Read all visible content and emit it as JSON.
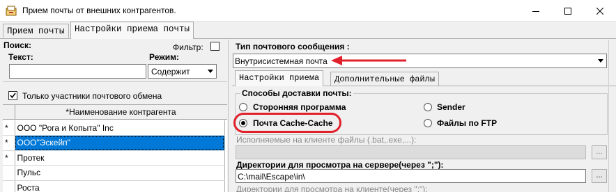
{
  "window": {
    "title": "Прием почты от внешних контрагентов.",
    "controls": {
      "minimize": "–",
      "maximize": "☐",
      "close": "✕"
    }
  },
  "tabs": [
    {
      "label": "Прием почты",
      "active": false
    },
    {
      "label": "Настройки приема почты",
      "active": true
    }
  ],
  "search": {
    "section_label": "Поиск:",
    "filter_label": "Фильтр:",
    "text_label": "Текст:",
    "text_value": "",
    "mode_label": "Режим:",
    "mode_value": "Содержит"
  },
  "participants_only": {
    "label": "Только участники почтового обмена",
    "checked": true
  },
  "grid": {
    "header": "*Наименование контрагента",
    "rows": [
      {
        "marker": "*",
        "name": "ООО \"Рога и Копыта\" Inc",
        "selected": false
      },
      {
        "marker": "*",
        "name": "ООО\"Эскейп\"",
        "selected": true
      },
      {
        "marker": "*",
        "name": "Протек",
        "selected": false
      },
      {
        "marker": "",
        "name": "Пульс",
        "selected": false
      },
      {
        "marker": "",
        "name": "Роста",
        "selected": false
      }
    ]
  },
  "message_type": {
    "label": "Тип почтового сообщения :",
    "value": "Внутрисистемная почта"
  },
  "inner_tabs": [
    {
      "label": "Настройки приема",
      "active": true
    },
    {
      "label": "Дополнительные файлы",
      "active": false
    }
  ],
  "delivery": {
    "group_label": "Способы доставки почты:",
    "options": [
      {
        "label": "Сторонняя программа",
        "checked": false
      },
      {
        "label": "Sender",
        "checked": false
      },
      {
        "label": "Почта Cache-Cache",
        "checked": true
      },
      {
        "label": "Файлы по FTP",
        "checked": false
      }
    ]
  },
  "client_files": {
    "label": "Исполняемые на клиенте файлы (.bat,.exe,...):",
    "value": "",
    "browse": "..."
  },
  "server_dirs": {
    "label": "Директории для просмотра на сервере(через \";\"):",
    "value": "C:\\mail\\Escape\\in\\",
    "browse": "..."
  },
  "client_dirs": {
    "label": "Директории для просмотра на клиенте(через \";\"):"
  },
  "colors": {
    "selection": "#0078d7",
    "highlight": "#e0202a"
  }
}
